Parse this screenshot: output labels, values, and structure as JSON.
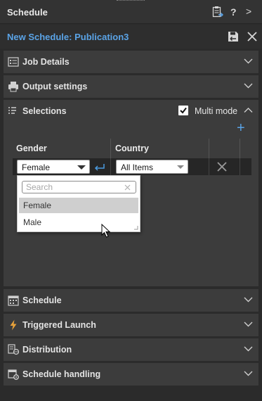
{
  "header": {
    "title": "Schedule",
    "help_label": "?",
    "expand_label": ">"
  },
  "subheader": {
    "title": "New Schedule: Publication3"
  },
  "sections": {
    "job_details": "Job Details",
    "output_settings": "Output settings",
    "selections": "Selections",
    "schedule": "Schedule",
    "triggered_launch": "Triggered Launch",
    "distribution": "Distribution",
    "schedule_handling": "Schedule handling"
  },
  "selections": {
    "multi_mode_label": "Multi mode",
    "multi_mode_checked": true,
    "add_label": "+",
    "columns": [
      "Gender",
      "Country"
    ],
    "row": {
      "gender_value": "Female",
      "country_value": "All Items"
    },
    "dropdown": {
      "search_placeholder": "Search",
      "options": [
        "Female",
        "Male"
      ],
      "selected": "Female"
    }
  },
  "colors": {
    "accent": "#5aa3e6",
    "panel": "#3c3c3c",
    "background": "#2b2b2b"
  }
}
